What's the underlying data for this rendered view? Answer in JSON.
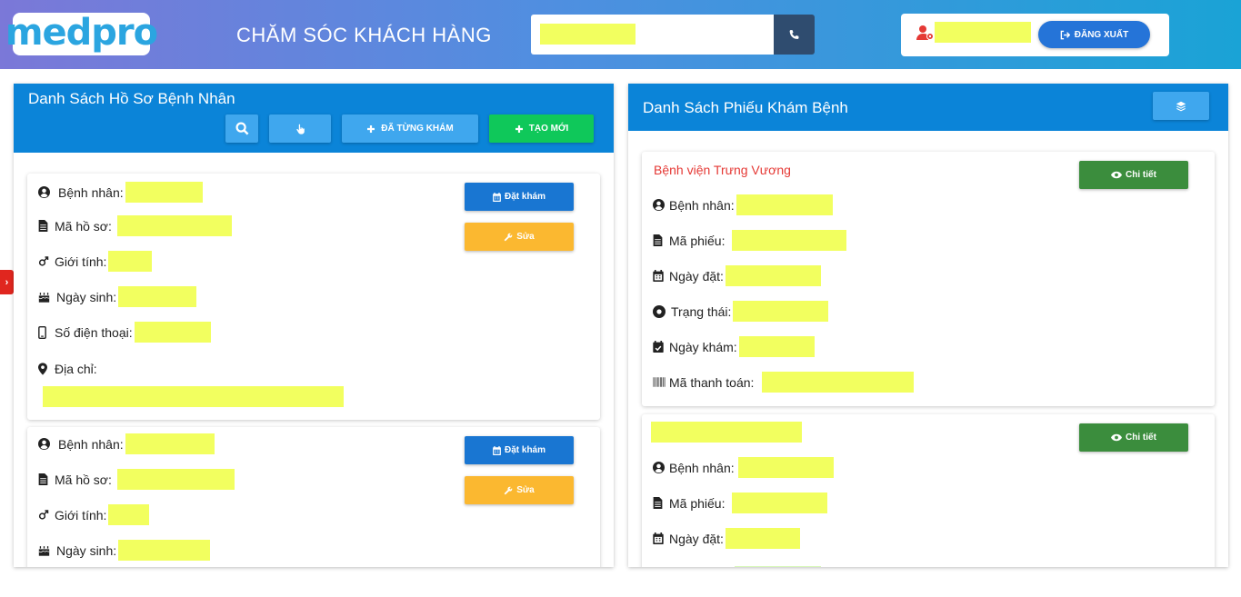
{
  "header": {
    "logo": "medpro",
    "title": "CHĂM SÓC KHÁCH HÀNG",
    "logout_label": "ĐĂNG XUẤT"
  },
  "left_panel": {
    "title": "Danh Sách Hồ Sơ Bệnh Nhân",
    "btn_history": "ĐÃ TỪNG KHÁM",
    "btn_new": "TẠO MỚI",
    "cards": [
      {
        "label_patient": "Bệnh nhân:",
        "label_record": "Mã hồ sơ:",
        "label_gender": "Giới tính:",
        "label_dob": "Ngày sinh:",
        "label_phone": "Số điện thoại:",
        "label_address": "Địa chỉ:",
        "btn_book": "Đặt khám",
        "btn_edit": "Sửa"
      },
      {
        "label_patient": "Bệnh nhân:",
        "label_record": "Mã hồ sơ:",
        "label_gender": "Giới tính:",
        "label_dob": "Ngày sinh:",
        "btn_book": "Đặt khám",
        "btn_edit": "Sửa"
      }
    ]
  },
  "right_panel": {
    "title": "Danh Sách Phiếu Khám Bệnh",
    "cards": [
      {
        "hospital": "Bệnh viện Trưng Vương",
        "btn_detail": "Chi tiết",
        "label_patient": "Bệnh nhân:",
        "label_ticket": "Mã phiếu:",
        "label_booked": "Ngày đặt:",
        "label_status": "Trạng thái:",
        "label_exam_date": "Ngày khám:",
        "label_payment": "Mã thanh toán:"
      },
      {
        "btn_detail": "Chi tiết",
        "label_patient": "Bệnh nhân:",
        "label_ticket": "Mã phiếu:",
        "label_booked": "Ngày đặt:"
      }
    ]
  },
  "colors": {
    "accent": "#0b84d8",
    "highlight": "#f2ff5f",
    "book": "#1976d2",
    "edit": "#fbb830",
    "new": "#0fc85a",
    "detail": "#3b8d3d",
    "hospital": "#e53935"
  }
}
